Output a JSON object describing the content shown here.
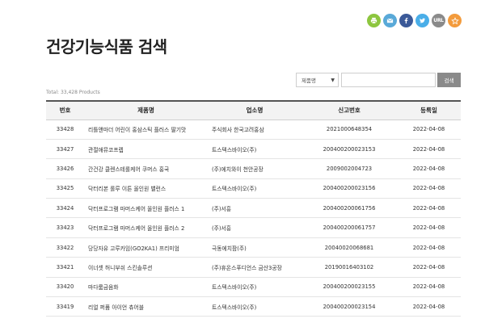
{
  "share_icons": [
    "print-icon",
    "mail-icon",
    "facebook-icon",
    "twitter-icon",
    "url-icon",
    "bookmark-icon"
  ],
  "share": {
    "url_label": "URL"
  },
  "page": {
    "title": "건강기능식품 검색"
  },
  "search": {
    "filter_label": "제품명",
    "query": "",
    "button_label": "검색"
  },
  "total_label": "Total: 33,428 Products",
  "table": {
    "columns": [
      "번호",
      "제품명",
      "업소명",
      "신고번호",
      "등록일"
    ],
    "rows": [
      {
        "no": "33428",
        "name": "리틀앤마더 어린이 홍삼스틱 플러스 딸기맛",
        "company": "주식회사 한국고려홍삼",
        "report": "2021000648354",
        "date": "2022-04-08"
      },
      {
        "no": "33427",
        "name": "관절애뮤코프렙",
        "company": "트스텍스바이오(주)",
        "report": "200400200023153",
        "date": "2022-04-08"
      },
      {
        "no": "33426",
        "name": "간건강 클렌스테롤케어 쿠머스 홍국",
        "company": "(주)에치와이 천안공장",
        "report": "2009002004723",
        "date": "2022-04-08"
      },
      {
        "no": "33425",
        "name": "닥터리본 롤루 이튼 올인원 밸런스",
        "company": "트스텍스바이오(주)",
        "report": "200400200023156",
        "date": "2022-04-08"
      },
      {
        "no": "33424",
        "name": "닥터프로그램 마머스케어 올인원 플러스 1",
        "company": "(주)서흥",
        "report": "200400200061756",
        "date": "2022-04-08"
      },
      {
        "no": "33423",
        "name": "닥터프로그램 마머스케어 올인원 플러스 2",
        "company": "(주)서흥",
        "report": "200400200061757",
        "date": "2022-04-08"
      },
      {
        "no": "33422",
        "name": "당당자유 고루카임(GO2KA1) 프리미엄",
        "company": "극동에치팜(주)",
        "report": "20040020068681",
        "date": "2022-04-08"
      },
      {
        "no": "33421",
        "name": "이너셋 허니부쉬 스킨솔루션",
        "company": "(주)휴온스푸디언스 금산3공장",
        "report": "20190016403102",
        "date": "2022-04-08"
      },
      {
        "no": "33420",
        "name": "마다룸금음화",
        "company": "트스텍스바이오(주)",
        "report": "200400200023155",
        "date": "2022-04-08"
      },
      {
        "no": "33419",
        "name": "리얼 퍼퓸 아이언 츄어블",
        "company": "트스텍스바이오(주)",
        "report": "200400200023154",
        "date": "2022-04-08"
      }
    ]
  },
  "colors": {
    "print": "#8dc63f",
    "mail": "#59a9d8",
    "facebook": "#3b5998",
    "twitter": "#4aaee8",
    "url": "#8a8a8a",
    "bookmark": "#f39b3c",
    "header_bg": "#f3f3f3",
    "header_border": "#555555",
    "search_button": "#8a8a8a"
  }
}
